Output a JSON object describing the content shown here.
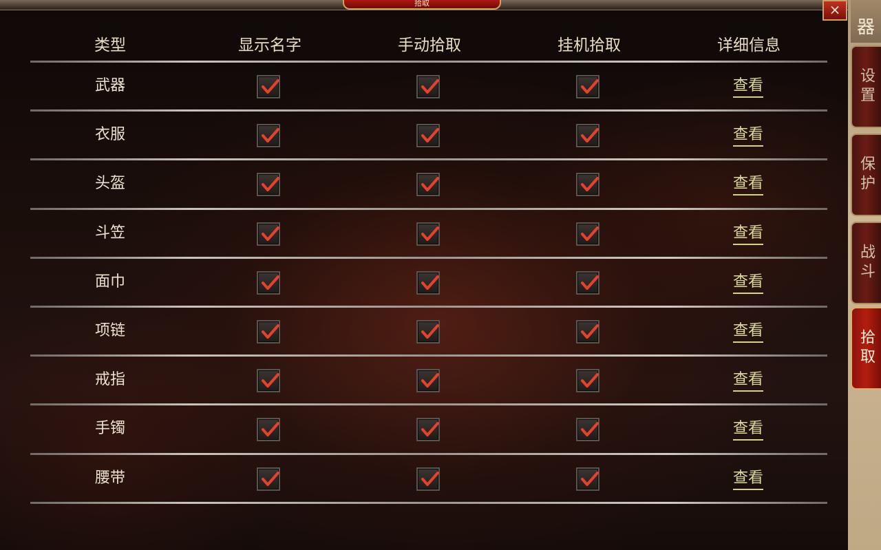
{
  "header": {
    "title": "拾取",
    "close_symbol": "×"
  },
  "sidebar": {
    "top_partial_label": "器",
    "tabs": [
      {
        "label": "设置",
        "active": false
      },
      {
        "label": "保护",
        "active": false
      },
      {
        "label": "战斗",
        "active": false
      },
      {
        "label": "拾取",
        "active": true
      }
    ]
  },
  "table": {
    "columns": [
      "类型",
      "显示名字",
      "手动拾取",
      "挂机拾取",
      "详细信息"
    ],
    "rows": [
      {
        "type": "武器",
        "show_name": true,
        "manual_pick": true,
        "auto_pick": true,
        "detail": "查看"
      },
      {
        "type": "衣服",
        "show_name": true,
        "manual_pick": true,
        "auto_pick": true,
        "detail": "查看"
      },
      {
        "type": "头盔",
        "show_name": true,
        "manual_pick": true,
        "auto_pick": true,
        "detail": "查看"
      },
      {
        "type": "斗笠",
        "show_name": true,
        "manual_pick": true,
        "auto_pick": true,
        "detail": "查看"
      },
      {
        "type": "面巾",
        "show_name": true,
        "manual_pick": true,
        "auto_pick": true,
        "detail": "查看"
      },
      {
        "type": "项链",
        "show_name": true,
        "manual_pick": true,
        "auto_pick": true,
        "detail": "查看"
      },
      {
        "type": "戒指",
        "show_name": true,
        "manual_pick": true,
        "auto_pick": true,
        "detail": "查看"
      },
      {
        "type": "手镯",
        "show_name": true,
        "manual_pick": true,
        "auto_pick": true,
        "detail": "查看"
      },
      {
        "type": "腰带",
        "show_name": true,
        "manual_pick": true,
        "auto_pick": true,
        "detail": "查看"
      }
    ]
  },
  "colors": {
    "check": "#e8402a",
    "link": "#dbd99a",
    "active_tab": "#b41c10"
  }
}
